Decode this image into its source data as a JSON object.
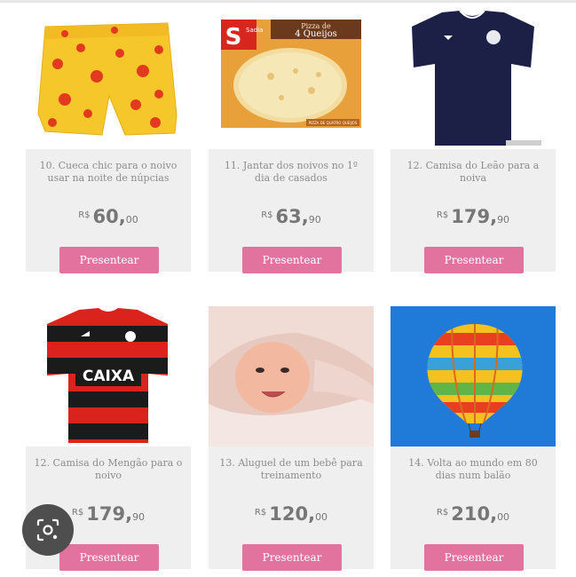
{
  "products": [
    {
      "title": "10. Cueca chic para o noivo usar na noite de núpcias",
      "currency": "R$",
      "price_int": "60,",
      "price_dec": "00",
      "button": "Presentear",
      "image": "polka-dot-boxer-shorts-image"
    },
    {
      "title": "11. Jantar dos noivos no 1º dia de casados",
      "currency": "R$",
      "price_int": "63,",
      "price_dec": "90",
      "button": "Presentear",
      "image": "frozen-pizza-box-image",
      "image_text": {
        "brand": "Sadia",
        "badge": "S",
        "flavor_line1": "Pizza de",
        "flavor_line2": "4 Queijos",
        "footnote": "PIZZA DE QUATRO QUEIJOS"
      }
    },
    {
      "title": "12. Camisa do Leão para a noiva",
      "currency": "R$",
      "price_int": "179,",
      "price_dec": "90",
      "button": "Presentear",
      "image": "navy-football-shirt-image"
    },
    {
      "title": "12. Camisa do Mengão para o noivo",
      "currency": "R$",
      "price_int": "179,",
      "price_dec": "90",
      "button": "Presentear",
      "image": "red-black-football-shirt-image",
      "image_text": {
        "sponsor": "CAIXA"
      }
    },
    {
      "title": "13. Aluguel de um bebê para treinamento",
      "currency": "R$",
      "price_int": "120,",
      "price_dec": "00",
      "button": "Presentear",
      "image": "baby-in-towel-image"
    },
    {
      "title": "14. Volta ao mundo em 80 dias num balão",
      "currency": "R$",
      "price_int": "210,",
      "price_dec": "00",
      "button": "Presentear",
      "image": "hot-air-balloon-image"
    }
  ],
  "colors": {
    "button": "#e2739f",
    "card": "#efefef",
    "title_text": "#8c8c8c"
  },
  "overlay": {
    "icon": "lens-search-icon"
  }
}
